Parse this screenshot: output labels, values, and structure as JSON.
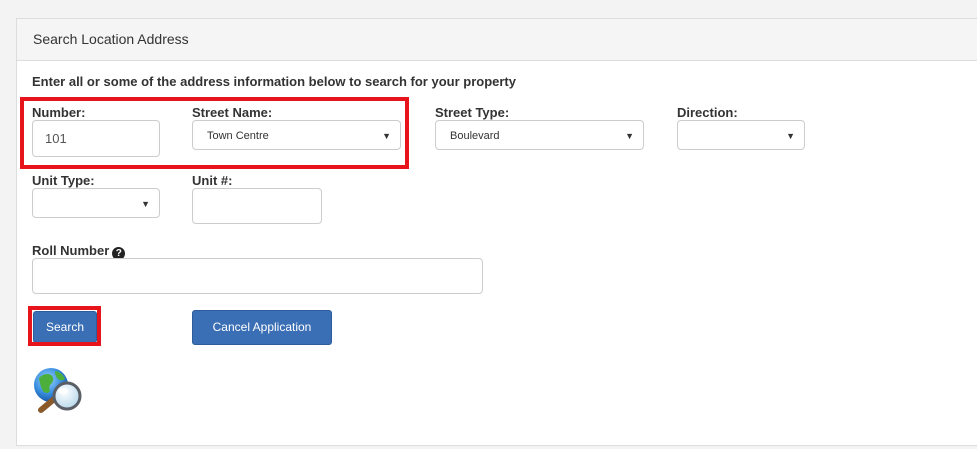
{
  "panel": {
    "title": "Search Location Address"
  },
  "form": {
    "instructions": "Enter all or some of the address information below to search for your property",
    "number": {
      "label": "Number:",
      "value": "101"
    },
    "street_name": {
      "label": "Street Name:",
      "value": "Town Centre"
    },
    "street_type": {
      "label": "Street Type:",
      "value": "Boulevard"
    },
    "direction": {
      "label": "Direction:",
      "value": ""
    },
    "unit_type": {
      "label": "Unit Type:",
      "value": ""
    },
    "unit_number": {
      "label": "Unit #:",
      "value": ""
    },
    "roll_number": {
      "label": "Roll Number",
      "value": "",
      "help_icon": "question-circle-icon",
      "help_glyph": "?"
    }
  },
  "buttons": {
    "search": "Search",
    "cancel": "Cancel Application"
  },
  "icons": {
    "caret": "▼",
    "globe": "globe-magnifier-icon"
  },
  "colors": {
    "primary_button": "#3a6eb5",
    "highlight": "#e8141c"
  }
}
